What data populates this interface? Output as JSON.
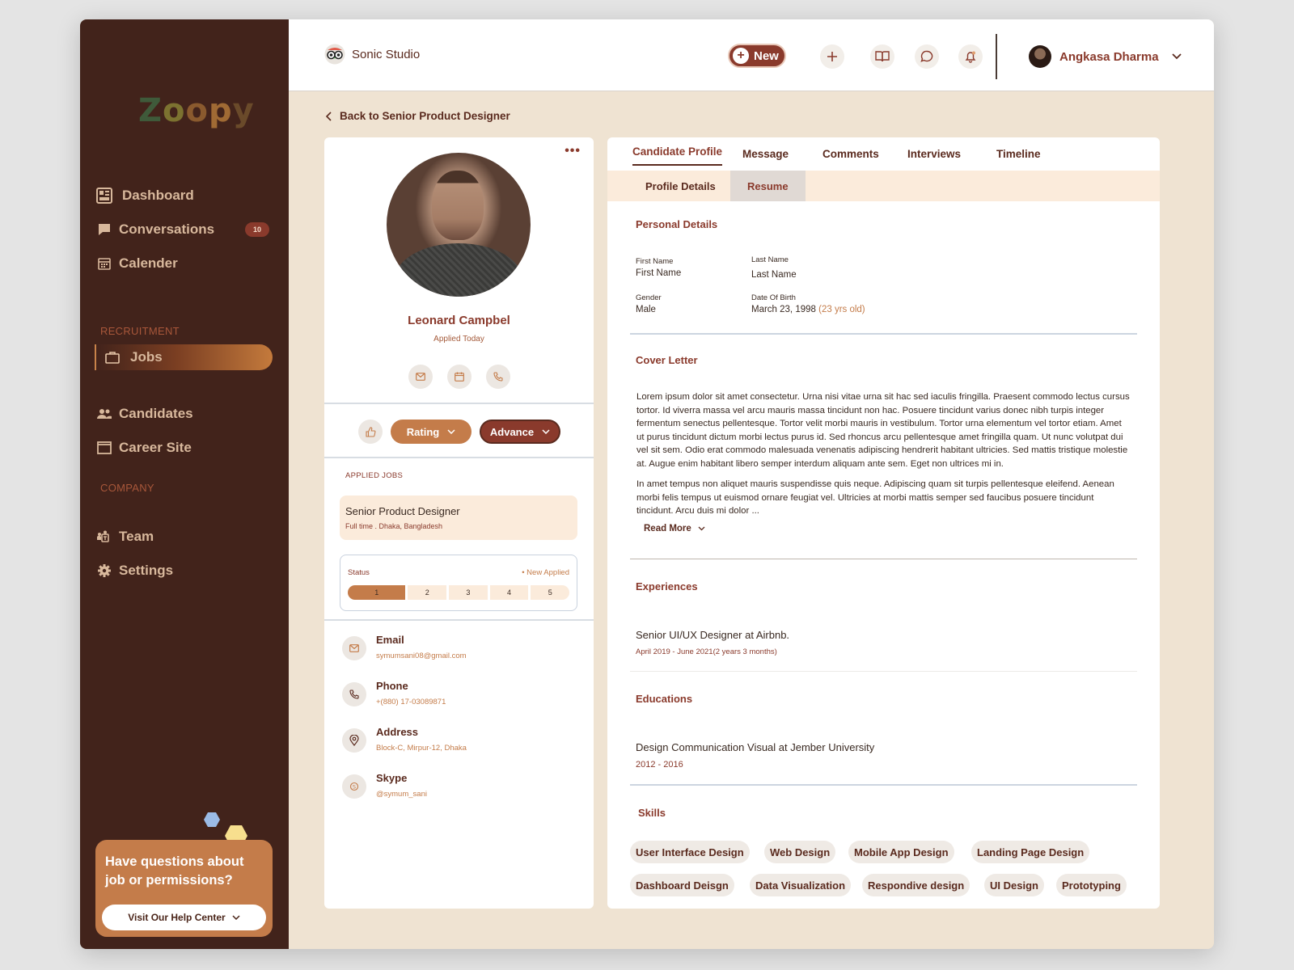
{
  "sidebar": {
    "logo": "Zoopy",
    "nav": [
      {
        "label": "Dashboard",
        "icon": "dashboard-icon"
      },
      {
        "label": "Conversations",
        "icon": "chat-icon",
        "badge": "10"
      },
      {
        "label": "Calender",
        "icon": "calendar-icon"
      },
      {
        "label": "Jobs",
        "icon": "briefcase-icon",
        "active": true
      },
      {
        "label": "Candidates",
        "icon": "users-icon"
      },
      {
        "label": "Career Site",
        "icon": "window-icon"
      },
      {
        "label": "Team",
        "icon": "team-icon"
      },
      {
        "label": "Settings",
        "icon": "gear-icon"
      }
    ],
    "section_recruitment": "RECRUITMENT",
    "section_company": "COMPANY",
    "help": {
      "text": "Have questions about job or permissions?",
      "button": "Visit Our Help Center"
    }
  },
  "topbar": {
    "brand": "Sonic Studio",
    "new_label": "New",
    "user_name": "Angkasa Dharma"
  },
  "back_link": "Back to Senior Product Designer",
  "candidate": {
    "name": "Leonard Campbel",
    "applied": "Applied Today",
    "rating_label": "Rating",
    "advance_label": "Advance",
    "applied_jobs_label": "APPLIED JOBS",
    "job": {
      "title": "Senior Product Designer",
      "meta": "Full time . Dhaka, Bangladesh"
    },
    "status": {
      "label": "Status",
      "value": "• New Applied",
      "steps": [
        "1",
        "2",
        "3",
        "4",
        "5"
      ],
      "current": 1
    },
    "contacts": [
      {
        "title": "Email",
        "value": "symumsani08@gmail.com",
        "icon": "mail-icon"
      },
      {
        "title": "Phone",
        "value": "+(880) 17-03089871",
        "icon": "phone-icon"
      },
      {
        "title": "Address",
        "value": "Block-C, Mirpur-12, Dhaka",
        "icon": "location-icon"
      },
      {
        "title": "Skype",
        "value": "@symum_sani",
        "icon": "skype-icon"
      }
    ]
  },
  "tabs": [
    "Candidate Profile",
    "Message",
    "Comments",
    "Interviews",
    "Timeline"
  ],
  "subtabs": [
    "Profile Details",
    "Resume"
  ],
  "profile": {
    "personal_title": "Personal Details",
    "first_name_label": "First Name",
    "first_name_value": "First Name",
    "last_name_label": "Last Name",
    "last_name_value": "Last Name",
    "gender_label": "Gender",
    "gender_value": "Male",
    "dob_label": "Date Of Birth",
    "dob_value": "March 23, 1998",
    "age": "(23 yrs old)",
    "cover_title": "Cover Letter",
    "cover_p1": "Lorem ipsum dolor sit amet consectetur. Urna nisi vitae urna sit hac sed iaculis fringilla. Praesent commodo lectus cursus tortor. Id viverra massa vel arcu mauris massa tincidunt non hac. Posuere tincidunt varius donec nibh turpis integer fermentum senectus pellentesque. Tortor velit morbi mauris in vestibulum. Tortor urna elementum vel tortor etiam. Amet ut purus tincidunt dictum morbi lectus purus id. Sed rhoncus arcu pellentesque amet fringilla quam. Ut nunc volutpat dui vel sit sem. Odio erat commodo malesuada venenatis adipiscing hendrerit habitant ultricies. Sed mattis tristique molestie at. Augue enim habitant libero semper interdum aliquam ante sem. Eget non ultrices mi in.",
    "cover_p2": "In amet tempus non aliquet mauris suspendisse quis neque. Adipiscing quam sit turpis pellentesque eleifend. Aenean morbi felis tempus ut euismod ornare feugiat vel. Ultricies at morbi mattis semper sed faucibus posuere tincidunt tincidunt. Arcu duis mi dolor ...",
    "read_more": "Read More",
    "exp_title": "Experiences",
    "exp_role": "Senior UI/UX Designer at Airbnb.",
    "exp_dates": "April 2019 - June 2021(2 years 3 months)",
    "edu_title": "Educations",
    "edu_school": "Design Communication Visual at Jember University",
    "edu_dates": "2012 - 2016",
    "skills_title": "Skills",
    "skills": [
      "User Interface Design",
      "Web Design",
      "Mobile App Design",
      "Landing Page Design",
      "Dashboard Deisgn",
      "Data Visualization",
      "Respondive design",
      "UI Design",
      "Prototyping"
    ]
  }
}
